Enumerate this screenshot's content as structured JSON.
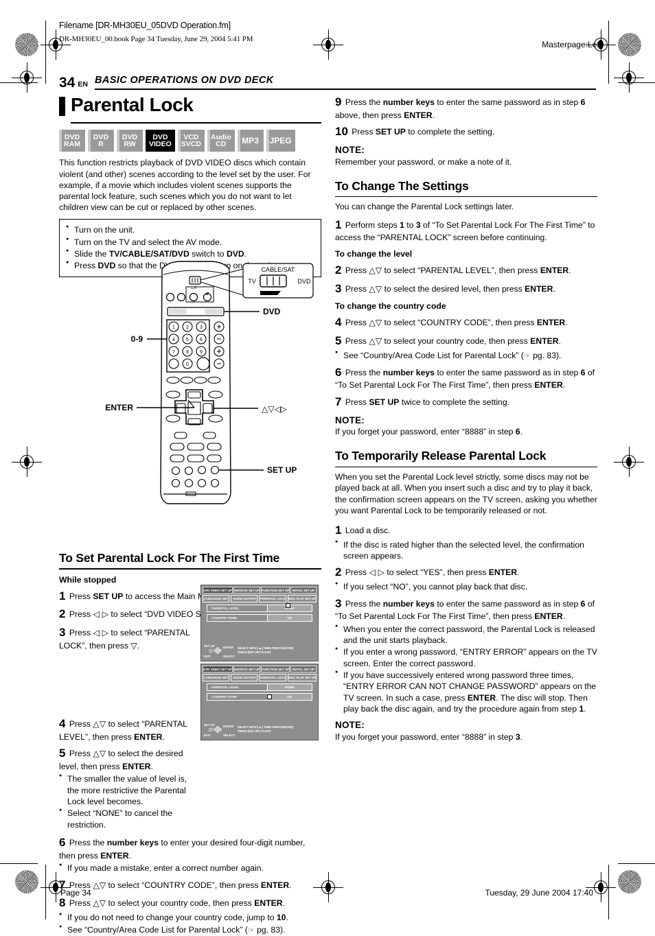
{
  "print_header": {
    "filename": "Filename [DR-MH30EU_05DVD Operation.fm]",
    "bookline": "DR-MH30EU_00.book  Page 34  Tuesday, June 29, 2004  5:41 PM",
    "masterpage": "Masterpage:Left"
  },
  "page_head": {
    "page_number": "34",
    "lang": "EN",
    "chapter": "BASIC OPERATIONS ON DVD DECK"
  },
  "title": "Parental Lock",
  "badges": [
    {
      "l1": "DVD",
      "l2": "RAM",
      "active": false
    },
    {
      "l1": "DVD",
      "l2": "R",
      "active": false
    },
    {
      "l1": "DVD",
      "l2": "RW",
      "active": false
    },
    {
      "l1": "DVD",
      "l2": "VIDEO",
      "active": true
    },
    {
      "l1": "VCD",
      "l2": "SVCD",
      "active": false
    },
    {
      "l1": "Audio",
      "l2": "CD",
      "active": false
    },
    {
      "l1": "MP3",
      "l2": "",
      "active": false
    },
    {
      "l1": "JPEG",
      "l2": "",
      "active": false
    }
  ],
  "intro": "This function restricts playback of DVD VIDEO discs which contain violent (and other) scenes according to the level set by the user. For example, if a movie which includes violent scenes supports the parental lock feature, such scenes which you do not want to let children view can be cut or replaced by other scenes.",
  "prereq": [
    "Turn on the unit.",
    "Turn on the TV and select the AV mode.",
    "Slide the TV/CABLE/SAT/DVD switch to DVD.",
    "Press DVD so that the DVD lamp lights up on the unit."
  ],
  "remote": {
    "callouts": {
      "zero_nine": "0-9",
      "enter": "ENTER",
      "dvd": "DVD",
      "set_up": "SET UP",
      "arrows": "△▽◁▷"
    },
    "switch": {
      "top": "CABLE/SAT",
      "left": "TV",
      "right": "DVD"
    },
    "keypad": [
      "1",
      "2",
      "3",
      "4",
      "5",
      "6",
      "7",
      "8",
      "9",
      "0"
    ]
  },
  "sections": {
    "first_time": {
      "heading": "To Set Parental Lock For The First Time",
      "while_stopped": "While stopped",
      "steps": [
        {
          "n": "1",
          "text": "Press <b>SET UP</b> to access the Main Menu screen."
        },
        {
          "n": "2",
          "text": "Press <span class=\"sym\">◁ ▷</span> to select “DVD VIDEO SET UP”, then press <span class=\"sym\">▽</span>."
        },
        {
          "n": "3",
          "text": "Press <span class=\"sym\">◁ ▷</span> to select “PARENTAL LOCK”, then press <span class=\"sym\">▽</span>."
        },
        {
          "n": "4",
          "text": "Press <span class=\"sym\">△▽</span> to select “PARENTAL LEVEL”, then press <b>ENTER</b>."
        },
        {
          "n": "5",
          "text": "Press <span class=\"sym\">△▽</span> to select the desired level, then press <b>ENTER</b>."
        },
        {
          "n": "6",
          "text": "Press the <b>number keys</b> to enter your desired four-digit number, then press <b>ENTER</b>."
        },
        {
          "n": "7",
          "text": "Press <span class=\"sym\">△▽</span> to select “COUNTRY CODE”, then press <b>ENTER</b>."
        },
        {
          "n": "8",
          "text": "Press <span class=\"sym\">△▽</span> to select your country code, then press <b>ENTER</b>."
        },
        {
          "n": "9",
          "text": "Press the <b>number keys</b> to enter the same password as in step <b>6</b> above, then press <b>ENTER</b>."
        },
        {
          "n": "10",
          "text": "Press <b>SET UP</b> to complete the setting."
        }
      ],
      "bullets_after_5": [
        "The smaller the value of level is, the more restrictive the Parental Lock level becomes.",
        "Select “NONE” to cancel the restriction."
      ],
      "bullet_after_6": "If you made a mistake, enter a correct number again.",
      "bullets_after_8": [
        "If you do not need to change your country code, jump to <b>10</b>.",
        "See “Country/Area Code List for Parental Lock” (<span class=\"ptr\">☞</span> pg. 83)."
      ],
      "note_label": "NOTE:",
      "note_text": "Remember your password, or make a note of it."
    },
    "change_settings": {
      "heading": "To Change The Settings",
      "lead": "You can change the Parental Lock settings later.",
      "step1": {
        "n": "1",
        "text": "Perform steps <b>1</b> to <b>3</b> of “To Set Parental Lock For The First Time” to access the “PARENTAL LOCK” screen before continuing."
      },
      "sub_level": "To change the level",
      "steps_level": [
        {
          "n": "2",
          "text": "Press <span class=\"sym\">△▽</span> to select “PARENTAL LEVEL”, then press <b>ENTER</b>."
        },
        {
          "n": "3",
          "text": "Press <span class=\"sym\">△▽</span> to select the desired level, then press <b>ENTER</b>."
        }
      ],
      "sub_country": "To change the country code",
      "steps_country": [
        {
          "n": "4",
          "text": "Press <span class=\"sym\">△▽</span> to select “COUNTRY CODE”, then press <b>ENTER</b>."
        },
        {
          "n": "5",
          "text": "Press <span class=\"sym\">△▽</span> to select your country code, then press <b>ENTER</b>."
        }
      ],
      "bullet_after_5": "See “Country/Area Code List for Parental Lock” (<span class=\"ptr\">☞</span> pg. 83).",
      "steps_tail": [
        {
          "n": "6",
          "text": "Press the <b>number keys</b> to enter the same password as in step <b>6</b> of “To Set Parental Lock For The First Time”, then press <b>ENTER</b>."
        },
        {
          "n": "7",
          "text": "Press <b>SET UP</b> twice to complete the setting."
        }
      ],
      "note_label": "NOTE:",
      "note_text": "If you forget your password, enter “8888” in step <b>6</b>."
    },
    "temp_release": {
      "heading": "To Temporarily Release Parental Lock",
      "lead": "When you set the Parental Lock level strictly, some discs may not be played back at all. When you insert such a disc and try to play it back, the confirmation screen appears on the TV screen, asking you whether you want Parental Lock to be temporarily released or not.",
      "steps": [
        {
          "n": "1",
          "text": "Load a disc."
        },
        {
          "n": "2",
          "text": "Press <span class=\"sym\">◁ ▷</span> to select “YES”, then press <b>ENTER</b>."
        },
        {
          "n": "3",
          "text": "Press the <b>number keys</b> to enter the same password as in step <b>6</b> of “To Set Parental Lock For The First Time”, then press <b>ENTER</b>."
        }
      ],
      "bullet_after_1": "If the disc is rated higher than the selected level, the confirmation screen appears.",
      "bullet_after_2": "If you select “NO”, you cannot play back that disc.",
      "bullets_after_3": [
        "When you enter the correct password, the Parental Lock is released and the unit starts playback.",
        "If you enter a wrong password, “ENTRY ERROR” appears on the TV screen. Enter the correct password.",
        "If you have successively entered wrong password three times, “ENTRY ERROR CAN NOT CHANGE PASSWORD” appears on the TV screen. In such a case, press <b>ENTER</b>. The disc will stop. Then play back the disc again, and try the procedure again from step <b>1</b>."
      ],
      "note_label": "NOTE:",
      "note_text": "If you forget your password, enter “8888” in step <b>3</b>."
    }
  },
  "osd": {
    "tabs": [
      "DVD VIDEO SET UP",
      "HDD/DVD SET UP",
      "FUNCTION SET UP",
      "INITIAL SET UP"
    ],
    "subtabs": [
      "LANGUAGE SET",
      "AUDIO OUTPUT",
      "PARENTAL LOCK",
      "DISC PLAY SET UP"
    ],
    "rows": [
      {
        "label": "PARENTAL LEVEL",
        "value": "NONE"
      },
      {
        "label": "COUNTRY CODE",
        "value": "US"
      }
    ],
    "footer": {
      "set_up": "SET UP",
      "exit": "EXIT",
      "enter": "ENTER",
      "select": "SELECT",
      "help1": "SELECT WITH [ ◂▸ ] THEN PRESS [ENTER]",
      "help2": "PRESS [SET UP] TO EXIT"
    }
  },
  "footer": {
    "left": "Page 34",
    "right": "Tuesday, 29 June 2004  17:40"
  }
}
